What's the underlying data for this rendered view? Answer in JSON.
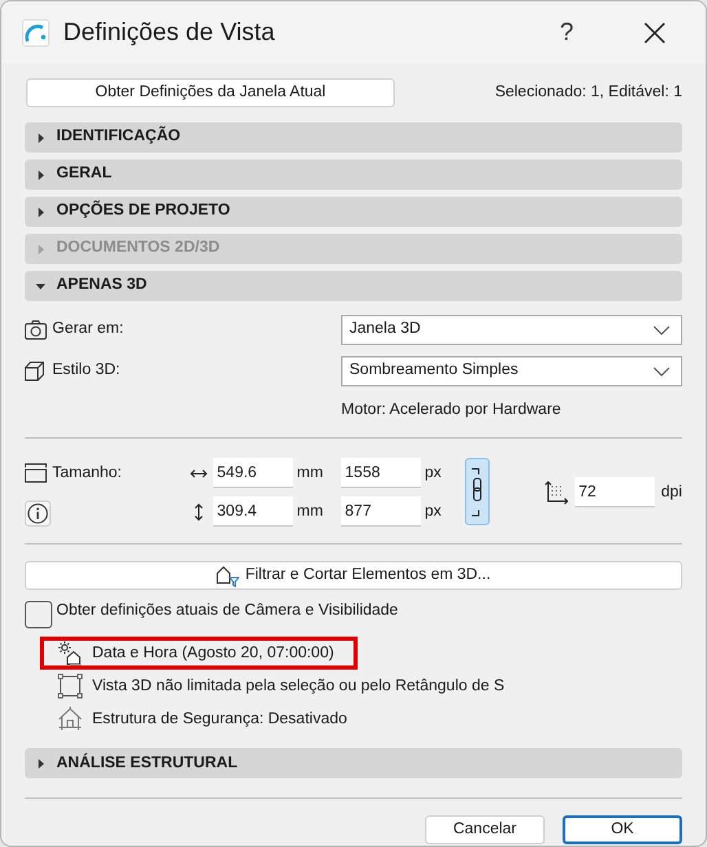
{
  "window": {
    "title": "Definições de Vista",
    "help": "?"
  },
  "top": {
    "button": "Obter Definições da Janela Atual",
    "status": "Selecionado: 1, Editável: 1"
  },
  "sections": [
    {
      "label": "IDENTIFICAÇÃO",
      "expanded": false,
      "disabled": false
    },
    {
      "label": "GERAL",
      "expanded": false,
      "disabled": false
    },
    {
      "label": "OPÇÕES DE PROJETO",
      "expanded": false,
      "disabled": false
    },
    {
      "label": "DOCUMENTOS 2D/3D",
      "expanded": false,
      "disabled": true
    },
    {
      "label": "APENAS 3D",
      "expanded": true,
      "disabled": false
    }
  ],
  "apenas_3d": {
    "fields": [
      {
        "kind": "camera",
        "label": "Gerar em:",
        "value": "Janela 3D"
      },
      {
        "kind": "cube",
        "label": "Estilo 3D:",
        "value": "Sombreamento Simples"
      }
    ],
    "engine_note": "Motor: Acelerado por Hardware",
    "size": {
      "label": "Tamanho:",
      "rows": [
        {
          "kind": "horizontal",
          "mm": "549.6",
          "mm_unit": "mm",
          "px": "1558",
          "px_unit": "px"
        },
        {
          "kind": "vertical",
          "mm": "309.4",
          "mm_unit": "mm",
          "px": "877",
          "px_unit": "px"
        }
      ],
      "linked": true,
      "resolution": "72",
      "resolution_unit": "dpi"
    },
    "filter_button": "Filtrar e Cortar Elementos em 3D...",
    "camera_checkbox": {
      "label": "Obter definições atuais de Câmera e Visibilidade",
      "checked": false
    },
    "info_rows": [
      {
        "kind": "sun",
        "text": "Data e Hora (Agosto 20, 07:00:00)",
        "highlighted": true
      },
      {
        "kind": "frame",
        "text": "Vista 3D não limitada pela seleção ou pelo Retângulo de S",
        "highlighted": false
      },
      {
        "kind": "house",
        "text": "Estrutura de Segurança: Desativado",
        "highlighted": false
      }
    ]
  },
  "structural_section": {
    "label": "ANÁLISE ESTRUTURAL",
    "expanded": false,
    "disabled": false
  },
  "buttons": [
    {
      "label": "Cancelar",
      "default": false
    },
    {
      "label": "OK",
      "default": true
    }
  ]
}
